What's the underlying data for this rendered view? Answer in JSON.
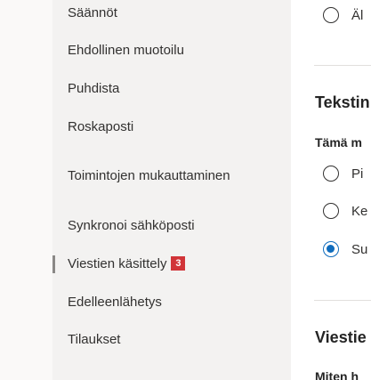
{
  "nav": {
    "items": [
      {
        "label": "Säännöt"
      },
      {
        "label": "Ehdollinen muotoilu"
      },
      {
        "label": "Puhdista"
      },
      {
        "label": "Roskaposti"
      },
      {
        "label": "Toimintojen mukauttaminen"
      },
      {
        "label": "Synkronoi sähköposti"
      },
      {
        "label": "Viestien käsittely",
        "badge": "3",
        "selected": true
      },
      {
        "label": "Edelleenlähetys"
      },
      {
        "label": "Tilaukset"
      }
    ]
  },
  "main": {
    "top_option": {
      "label": "Äl",
      "checked": false
    },
    "text_section": {
      "title": "Tekstin",
      "subtitle": "Tämä m",
      "options": [
        {
          "label": "Pi",
          "checked": false
        },
        {
          "label": "Ke",
          "checked": false
        },
        {
          "label": "Su",
          "checked": true
        }
      ]
    },
    "message_section": {
      "title": "Viestie",
      "subtitle": "Miten h"
    }
  },
  "colors": {
    "badge": "#d13438",
    "radio_selected": "#0f6cbd",
    "nav_background": "#f3f2f1"
  }
}
